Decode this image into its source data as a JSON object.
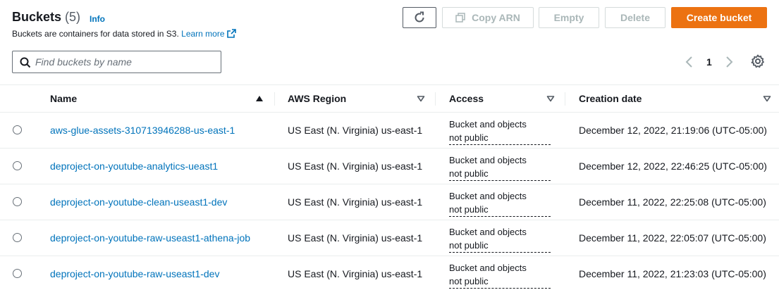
{
  "header": {
    "title": "Buckets",
    "count": "(5)",
    "info": "Info",
    "description": "Buckets are containers for data stored in S3.",
    "learn_more": "Learn more"
  },
  "actions": {
    "refresh_icon": "refresh-icon",
    "copy_arn": "Copy ARN",
    "empty": "Empty",
    "delete": "Delete",
    "create": "Create bucket",
    "create_color": "#ec7211"
  },
  "search": {
    "placeholder": "Find buckets by name",
    "value": ""
  },
  "pagination": {
    "current_page": "1"
  },
  "table": {
    "columns": {
      "name": "Name",
      "region": "AWS Region",
      "access": "Access",
      "created": "Creation date"
    },
    "rows": [
      {
        "name": "aws-glue-assets-310713946288-us-east-1",
        "region": "US East (N. Virginia) us-east-1",
        "access_1": "Bucket and objects",
        "access_2": "not public",
        "created": "December 12, 2022, 21:19:06 (UTC-05:00)"
      },
      {
        "name": "deproject-on-youtube-analytics-ueast1",
        "region": "US East (N. Virginia) us-east-1",
        "access_1": "Bucket and objects",
        "access_2": "not public",
        "created": "December 12, 2022, 22:46:25 (UTC-05:00)"
      },
      {
        "name": "deproject-on-youtube-clean-useast1-dev",
        "region": "US East (N. Virginia) us-east-1",
        "access_1": "Bucket and objects",
        "access_2": "not public",
        "created": "December 11, 2022, 22:25:08 (UTC-05:00)"
      },
      {
        "name": "deproject-on-youtube-raw-useast1-athena-job",
        "region": "US East (N. Virginia) us-east-1",
        "access_1": "Bucket and objects",
        "access_2": "not public",
        "created": "December 11, 2022, 22:05:07 (UTC-05:00)"
      },
      {
        "name": "deproject-on-youtube-raw-useast1-dev",
        "region": "US East (N. Virginia) us-east-1",
        "access_1": "Bucket and objects",
        "access_2": "not public",
        "created": "December 11, 2022, 21:23:03 (UTC-05:00)"
      }
    ]
  }
}
